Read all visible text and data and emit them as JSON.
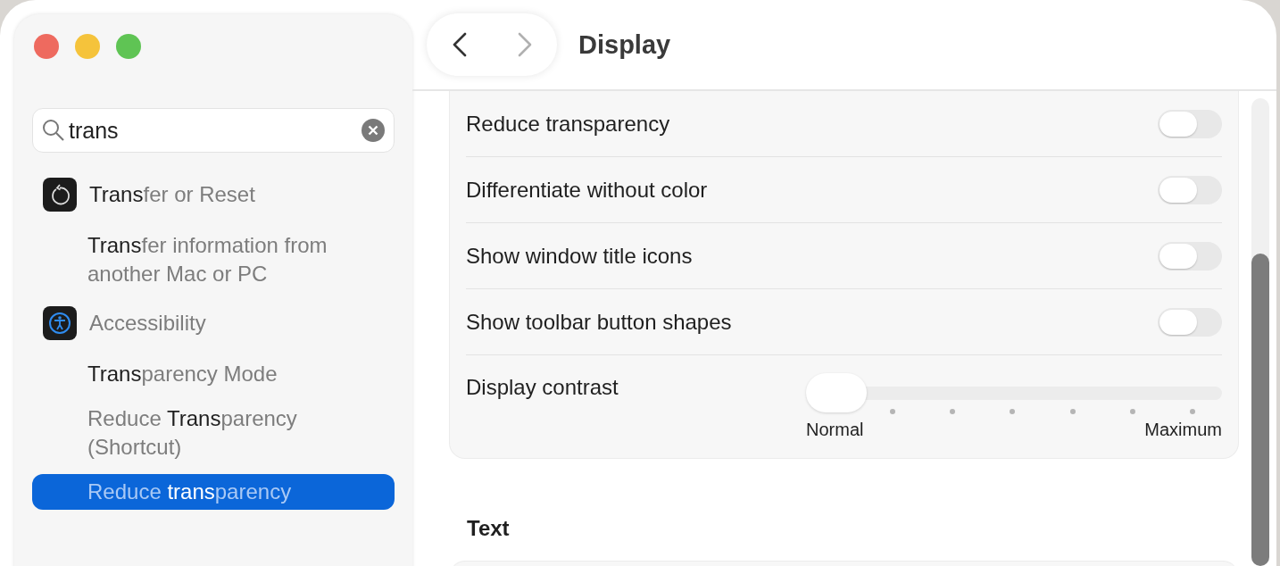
{
  "search": {
    "value": "trans"
  },
  "results": [
    {
      "kind": "app",
      "label": "**Trans**fer or Reset",
      "selected": false
    },
    {
      "kind": "option",
      "label": "**Trans**fer information from another Mac or PC",
      "selected": false
    },
    {
      "kind": "app",
      "label": "Accessibility",
      "selected": false
    },
    {
      "kind": "option",
      "label": "**Trans**parency Mode",
      "selected": false
    },
    {
      "kind": "option",
      "label": "Reduce **Trans**parency (Shortcut)",
      "selected": false
    },
    {
      "kind": "option",
      "label": "Reduce **trans**parency",
      "selected": true
    }
  ],
  "toolbar": {
    "back_disabled": false,
    "forward_disabled": true,
    "title": "Display"
  },
  "settings": [
    {
      "kind": "toggle",
      "label": "Reduce transparency",
      "on": false
    },
    {
      "kind": "toggle",
      "label": "Differentiate without color",
      "on": false
    },
    {
      "kind": "toggle",
      "label": "Show window title icons",
      "on": false
    },
    {
      "kind": "toggle",
      "label": "Show toolbar button shapes",
      "on": false
    },
    {
      "kind": "slider",
      "label": "Display contrast",
      "level": 0,
      "min_label": "Normal",
      "max_label": "Maximum"
    }
  ],
  "section_title": "Text"
}
